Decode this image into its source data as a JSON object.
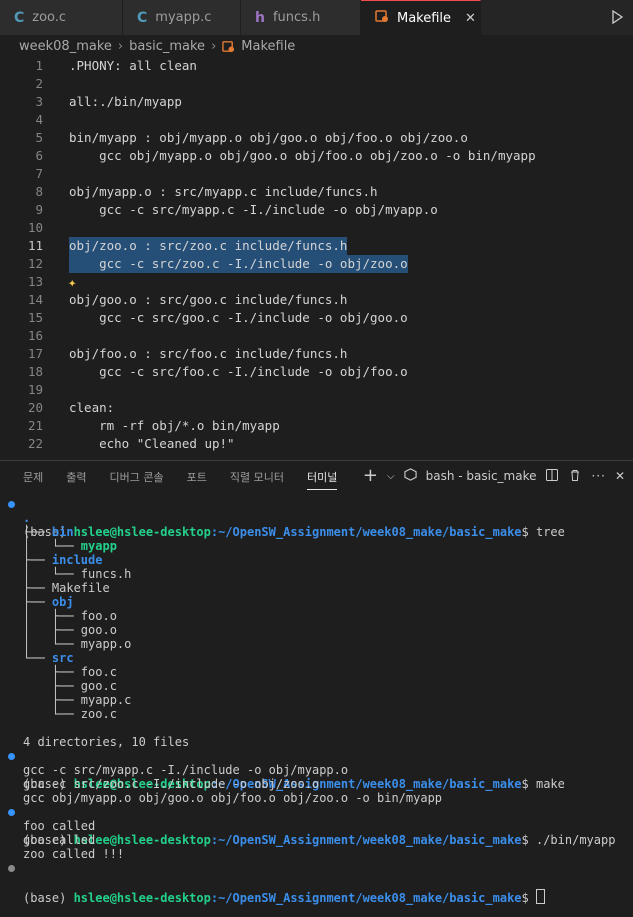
{
  "tabs": [
    {
      "label": "zoo.c",
      "icon": "C",
      "icon_color": "#519aba"
    },
    {
      "label": "myapp.c",
      "icon": "C",
      "icon_color": "#519aba"
    },
    {
      "label": "funcs.h",
      "icon": "h",
      "icon_color": "#a074c4"
    },
    {
      "label": "Makefile",
      "icon": "makefile-icon",
      "icon_color": "#e37933",
      "active": true,
      "close": "✕"
    }
  ],
  "breadcrumb": [
    "week08_make",
    "basic_make",
    "Makefile"
  ],
  "editor": {
    "lines": [
      {
        "n": "1",
        "text": ".PHONY: all clean"
      },
      {
        "n": "2",
        "text": ""
      },
      {
        "n": "3",
        "text": "all:./bin/myapp"
      },
      {
        "n": "4",
        "text": ""
      },
      {
        "n": "5",
        "text": "bin/myapp : obj/myapp.o obj/goo.o obj/foo.o obj/zoo.o"
      },
      {
        "n": "6",
        "text": "    gcc obj/myapp.o obj/goo.o obj/foo.o obj/zoo.o -o bin/myapp"
      },
      {
        "n": "7",
        "text": ""
      },
      {
        "n": "8",
        "text": "obj/myapp.o : src/myapp.c include/funcs.h"
      },
      {
        "n": "9",
        "text": "    gcc -c src/myapp.c -I./include -o obj/myapp.o"
      },
      {
        "n": "10",
        "text": ""
      },
      {
        "n": "11",
        "text": "obj/zoo.o : src/zoo.c include/funcs.h"
      },
      {
        "n": "12",
        "text": "    gcc -c src/zoo.c -I./include -o obj/zoo.o"
      },
      {
        "n": "13",
        "text": ""
      },
      {
        "n": "14",
        "text": "obj/goo.o : src/goo.c include/funcs.h"
      },
      {
        "n": "15",
        "text": "    gcc -c src/goo.c -I./include -o obj/goo.o"
      },
      {
        "n": "16",
        "text": ""
      },
      {
        "n": "17",
        "text": "obj/foo.o : src/foo.c include/funcs.h"
      },
      {
        "n": "18",
        "text": "    gcc -c src/foo.c -I./include -o obj/foo.o"
      },
      {
        "n": "19",
        "text": ""
      },
      {
        "n": "20",
        "text": "clean:"
      },
      {
        "n": "21",
        "text": "    rm -rf obj/*.o bin/myapp"
      },
      {
        "n": "22",
        "text": "    echo \"Cleaned up!\""
      }
    ],
    "selected_lines": [
      "11",
      "12"
    ]
  },
  "panel": {
    "tabs": [
      "문제",
      "출력",
      "디버그 콘솔",
      "포트",
      "직렬 모니터",
      "터미널"
    ],
    "active_tab": "터미널",
    "terminal_name": "bash - basic_make",
    "add_label": "+"
  },
  "terminal": {
    "prompt_base": "(base) ",
    "prompt_user": "hslee@hslee-desktop",
    "prompt_path": ":~/OpenSW_Assignment/week08_make/basic_make",
    "prompt_end": "$ ",
    "cmd_tree": "tree",
    "tree": {
      "root": ".",
      "bin_prefix": "├── ",
      "bin": "bin",
      "myapp_prefix": "│   └── ",
      "myapp": "myapp",
      "include_prefix": "├── ",
      "include": "include",
      "funcs_prefix": "│   └── ",
      "funcs": "funcs.h",
      "makefile_prefix": "├── ",
      "makefile": "Makefile",
      "obj_prefix": "├── ",
      "obj": "obj",
      "obj_items": [
        {
          "prefix": "│   ├── ",
          "name": "foo.o"
        },
        {
          "prefix": "│   ├── ",
          "name": "goo.o"
        },
        {
          "prefix": "│   └── ",
          "name": "myapp.o"
        }
      ],
      "src_prefix": "└── ",
      "src": "src",
      "src_items": [
        {
          "prefix": "    ├── ",
          "name": "foo.c"
        },
        {
          "prefix": "    ├── ",
          "name": "goo.c"
        },
        {
          "prefix": "    ├── ",
          "name": "myapp.c"
        },
        {
          "prefix": "    └── ",
          "name": "zoo.c"
        }
      ],
      "summary": "4 directories, 10 files"
    },
    "cmd_make": "make",
    "make_output": [
      "gcc -c src/myapp.c -I./include -o obj/myapp.o",
      "gcc -c src/zoo.c -I./include -o obj/zoo.o",
      "gcc obj/myapp.o obj/goo.o obj/foo.o obj/zoo.o -o bin/myapp"
    ],
    "cmd_run": "./bin/myapp",
    "run_output": [
      "foo called",
      "goo called",
      "zoo called !!!"
    ]
  }
}
